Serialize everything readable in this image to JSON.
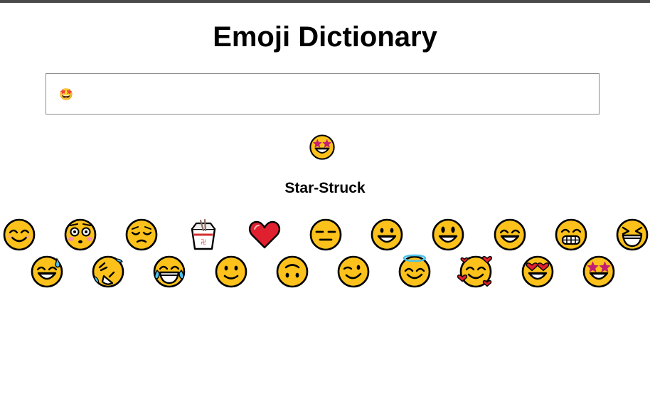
{
  "app": {
    "title": "Emoji Dictionary"
  },
  "search": {
    "value": "🤩",
    "placeholder": ""
  },
  "result": {
    "emoji": "🤩",
    "meaning": "Star-Struck"
  },
  "emoji_list": [
    {
      "emoji": "😊",
      "icon": "smiling-face-with-smiling-eyes-icon"
    },
    {
      "emoji": "😳",
      "icon": "flushed-face-icon"
    },
    {
      "emoji": "😔",
      "icon": "pensive-face-icon"
    },
    {
      "emoji": "🥡",
      "icon": "takeout-box-icon"
    },
    {
      "emoji": "❤️",
      "icon": "red-heart-icon"
    },
    {
      "emoji": "😑",
      "icon": "expressionless-face-icon"
    },
    {
      "emoji": "😀",
      "icon": "grinning-face-icon"
    },
    {
      "emoji": "😃",
      "icon": "grinning-face-with-big-eyes-icon"
    },
    {
      "emoji": "😄",
      "icon": "grinning-face-with-smiling-eyes-icon"
    },
    {
      "emoji": "😁",
      "icon": "beaming-face-icon"
    },
    {
      "emoji": "😆",
      "icon": "grinning-squinting-face-icon"
    },
    {
      "emoji": "😅",
      "icon": "grinning-face-with-sweat-icon"
    },
    {
      "emoji": "🤣",
      "icon": "rolling-on-floor-laughing-icon"
    },
    {
      "emoji": "😂",
      "icon": "face-with-tears-of-joy-icon"
    },
    {
      "emoji": "🙂",
      "icon": "slightly-smiling-face-icon"
    },
    {
      "emoji": "🙃",
      "icon": "upside-down-face-icon"
    },
    {
      "emoji": "😉",
      "icon": "winking-face-icon"
    },
    {
      "emoji": "😇",
      "icon": "smiling-face-with-halo-icon"
    },
    {
      "emoji": "🥰",
      "icon": "smiling-face-with-hearts-icon"
    },
    {
      "emoji": "😍",
      "icon": "smiling-face-with-heart-eyes-icon"
    },
    {
      "emoji": "🤩",
      "icon": "star-struck-icon"
    }
  ],
  "colors": {
    "face": "#FCC21B",
    "outline": "#000000",
    "heart": "#E0202F",
    "star": "#C21F74",
    "tear": "#4FC1E9",
    "blush": "#F6A2A6"
  }
}
